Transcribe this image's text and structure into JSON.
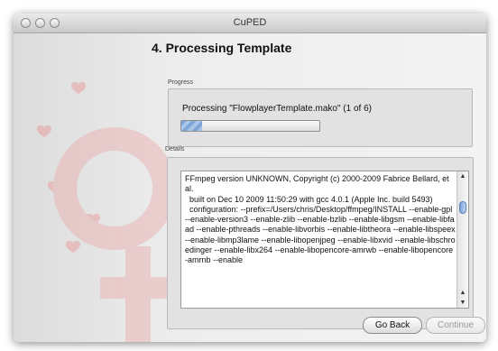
{
  "window": {
    "title": "CuPED",
    "traffic_lights": [
      "close",
      "minimize",
      "zoom"
    ]
  },
  "step": {
    "heading": "4. Processing Template"
  },
  "progress_group": {
    "label": "Progress",
    "status": "Processing \"FlowplayerTemplate.mako\" (1 of 6)",
    "progress_fraction": 0.15
  },
  "details_group": {
    "label": "Details",
    "log": "FFmpeg version UNKNOWN, Copyright (c) 2000-2009 Fabrice Bellard, et al.\n  built on Dec 10 2009 11:50:29 with gcc 4.0.1 (Apple Inc. build 5493)\n  configuration: --prefix=/Users/chris/Desktop/ffmpeg/INSTALL --enable-gpl --enable-version3 --enable-zlib --enable-bzlib --enable-libgsm --enable-libfaad --enable-pthreads --enable-libvorbis --enable-libtheora --enable-libspeex --enable-libmp3lame --enable-libopenjpeg --enable-libxvid --enable-libschroedinger --enable-libx264 --enable-libopencore-amrwb --enable-libopencore-amrnb --enable"
  },
  "buttons": {
    "back": "Go Back",
    "continue": "Continue"
  },
  "colors": {
    "accent_pink": "#e8a1a1",
    "progress_blue": "#7ea5d6"
  }
}
